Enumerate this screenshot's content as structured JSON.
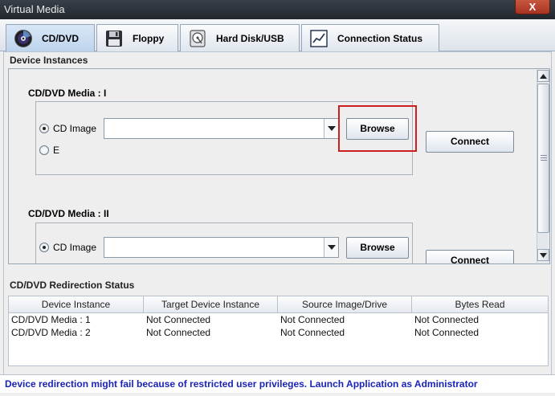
{
  "window": {
    "title": "Virtual Media",
    "close_label": "X"
  },
  "tabs": [
    {
      "label": "CD/DVD",
      "icon": "cd-icon",
      "active": true
    },
    {
      "label": "Floppy",
      "icon": "floppy-icon",
      "active": false
    },
    {
      "label": "Hard Disk/USB",
      "icon": "hard-disk-icon",
      "active": false
    },
    {
      "label": "Connection Status",
      "icon": "chart-icon",
      "active": false
    }
  ],
  "device_instances": {
    "header": "Device Instances",
    "groups": [
      {
        "title": "CD/DVD Media :  I",
        "options": [
          {
            "label": "CD Image",
            "selected": true
          },
          {
            "label": "E",
            "selected": false
          }
        ],
        "image_value": "",
        "browse_label": "Browse",
        "connect_label": "Connect"
      },
      {
        "title": "CD/DVD Media : II",
        "options": [
          {
            "label": "CD Image",
            "selected": true
          }
        ],
        "image_value": "",
        "browse_label": "Browse",
        "connect_label": "Connect"
      }
    ]
  },
  "redirection_status": {
    "header": "CD/DVD Redirection Status",
    "columns": [
      "Device Instance",
      "Target Device Instance",
      "Source Image/Drive",
      "Bytes Read"
    ],
    "rows": [
      [
        "CD/DVD Media :  1",
        "Not Connected",
        "Not Connected",
        "Not Connected"
      ],
      [
        "CD/DVD Media :  2",
        "Not Connected",
        "Not Connected",
        "Not Connected"
      ]
    ]
  },
  "status_message": "Device redirection might fail because of restricted user privileges. Launch Application as Administrator",
  "colors": {
    "highlight": "#cc2020",
    "status_text": "#1a23b8"
  }
}
